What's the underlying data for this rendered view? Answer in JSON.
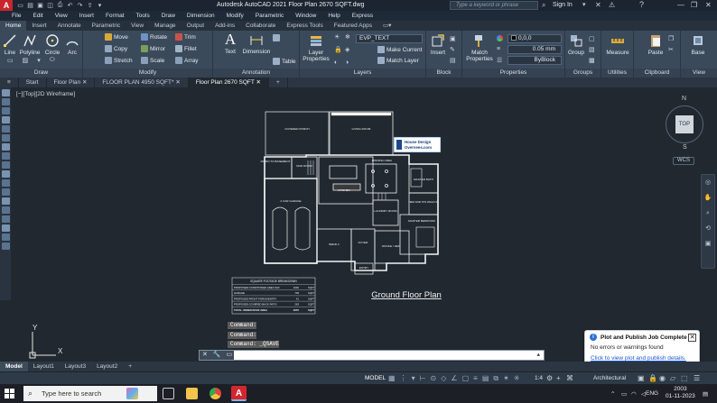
{
  "titlebar": {
    "app_letter": "A",
    "title": "Autodesk AutoCAD 2021    Floor Plan 2670 SQFT.dwg",
    "search_placeholder": "Type a keyword or phrase",
    "signin": "Sign In"
  },
  "menus": [
    "File",
    "Edit",
    "View",
    "Insert",
    "Format",
    "Tools",
    "Draw",
    "Dimension",
    "Modify",
    "Parametric",
    "Window",
    "Help",
    "Express"
  ],
  "ribbon_tabs": [
    "Home",
    "Insert",
    "Annotate",
    "Parametric",
    "View",
    "Manage",
    "Output",
    "Add-ins",
    "Collaborate",
    "Express Tools",
    "Featured Apps"
  ],
  "ribbon": {
    "draw": {
      "label": "Draw",
      "line": "Line",
      "polyline": "Polyline",
      "circle": "Circle",
      "arc": "Arc"
    },
    "modify": {
      "label": "Modify",
      "move": "Move",
      "rotate": "Rotate",
      "trim": "Trim",
      "copy": "Copy",
      "mirror": "Mirror",
      "fillet": "Fillet",
      "stretch": "Stretch",
      "scale": "Scale",
      "array": "Array"
    },
    "annotation": {
      "label": "Annotation",
      "text": "Text",
      "dimension": "Dimension",
      "table": "Table"
    },
    "layers": {
      "label": "Layers",
      "layer_properties": "Layer Properties",
      "current_layer": "EVP_TEXT",
      "make_current": "Make Current",
      "match_layer": "Match Layer"
    },
    "block": {
      "label": "Block",
      "insert": "Insert"
    },
    "properties": {
      "label": "Properties",
      "match_properties": "Match Properties",
      "color": "0,0,0",
      "lineweight": "0.05 mm",
      "linetype": "ByBlock"
    },
    "groups": {
      "label": "Groups",
      "group": "Group"
    },
    "utilities": {
      "label": "Utilities",
      "measure": "Measure"
    },
    "clipboard": {
      "label": "Clipboard",
      "paste": "Paste"
    },
    "view": {
      "label": "View",
      "base": "Base"
    }
  },
  "doc_tabs": [
    "Start",
    "Floor Plan",
    "FLOOR PLAN 4950 SQFT*",
    "Floor Plan 2670 SQFT"
  ],
  "viewport_label": "[−][Top][2D Wireframe]",
  "navcube": {
    "north": "N",
    "top": "TOP",
    "south": "S",
    "wcs": "WCS"
  },
  "drawing": {
    "title": "Ground Floor Plan",
    "logo_line1": "House Design",
    "logo_line2": "Oversees.com",
    "rooms": [
      "COVERED PORCH",
      "LIVING ROOM",
      "DINNING AREA",
      "MASTER BATH",
      "DOWN TO BASEMENT",
      "MUD ROOM",
      "KITCHEN",
      "2 CAR GARAGE",
      "HER AND HIS WALK IN",
      "MASTER BEDROOM",
      "LAUNDRY ROOM",
      "BEDR 2",
      "FOYER",
      "OFFICE / DEN",
      "ENTRY"
    ],
    "table": {
      "title": "SQUARE FOOTAGE BREAKDOWN",
      "rows": [
        [
          "PROPOSED CONDITIONED AREA SUF",
          "1640",
          "SQFT"
        ],
        [
          "GARAGE",
          "735",
          "SQFT"
        ],
        [
          "PROPOSED FRONT PORCH/ENTRY",
          "41",
          "SQFT"
        ],
        [
          "PROPOSED COVERED BACK PATIO",
          "263",
          "SQFT"
        ],
        [
          "TOTAL UNDER ROOF AREA",
          "2670",
          "SQFT"
        ]
      ]
    }
  },
  "command_history": [
    "Command:",
    "Command:",
    "Command: _QSAVE"
  ],
  "command_input": "",
  "notification": {
    "title": "Plot and Publish Job Complete",
    "body": "No errors or warnings found",
    "link": "Click to view plot and publish details."
  },
  "layout_tabs": [
    "Model",
    "Layout1",
    "Layout3",
    "Layout2"
  ],
  "status": {
    "model": "MODEL",
    "scale": "1:4",
    "units": "Architectural"
  },
  "axis": {
    "x": "X",
    "y": "Y"
  },
  "taskbar": {
    "search_placeholder": "Type here to search",
    "lang": "ENG",
    "time": "2003",
    "date": "01-11-2023"
  }
}
